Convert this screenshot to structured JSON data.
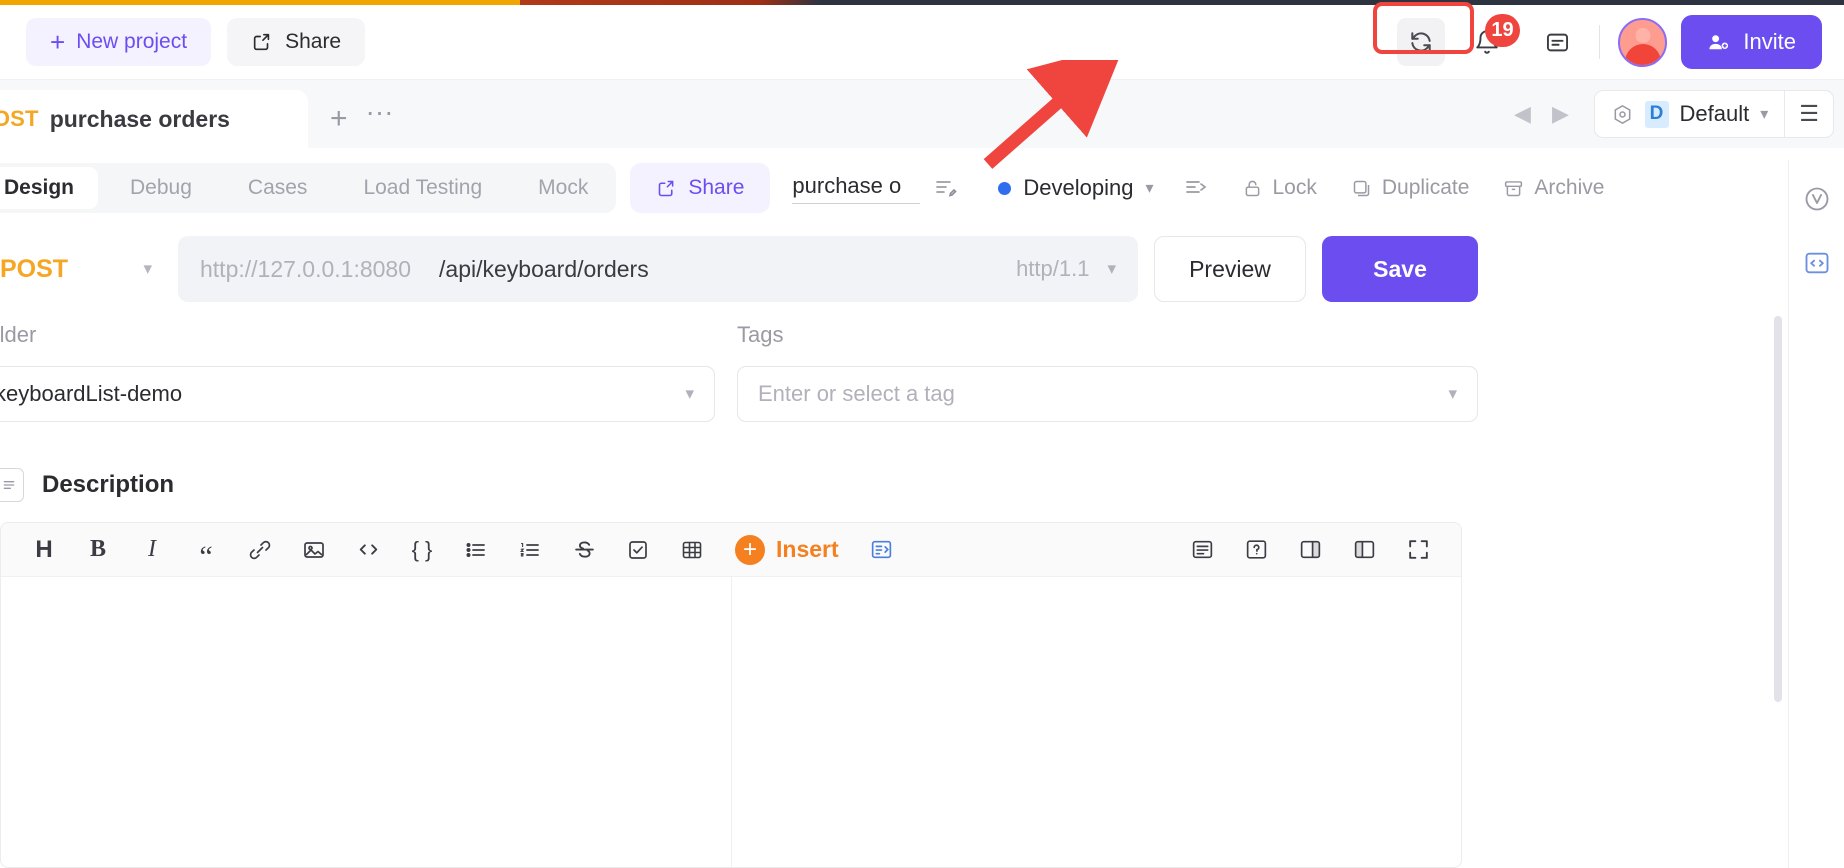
{
  "header": {
    "new_project_label": "New project",
    "share_label": "Share",
    "notification_count": "19",
    "invite_label": "Invite",
    "icons": {
      "plus": "plus-icon",
      "share": "share-icon",
      "refresh": "refresh-icon",
      "bell": "bell-icon",
      "note": "note-icon",
      "avatar": "avatar",
      "invite": "invite-user-icon"
    }
  },
  "tabbar": {
    "tab": {
      "method": "POST",
      "title": "purchase orders"
    },
    "add_tab_label": "+",
    "more_label": "···",
    "nav_prev": "◀",
    "nav_next": "▶",
    "environment": {
      "letter": "D",
      "name": "Default"
    }
  },
  "subtabs": {
    "items": [
      {
        "label": "Design",
        "active": true
      },
      {
        "label": "Debug",
        "active": false
      },
      {
        "label": "Cases",
        "active": false
      },
      {
        "label": "Load Testing",
        "active": false
      },
      {
        "label": "Mock",
        "active": false
      }
    ],
    "share_label": "Share",
    "api_name": "purchase o",
    "status": "Developing",
    "actions": [
      {
        "label": "Lock",
        "icon": "lock-icon"
      },
      {
        "label": "Duplicate",
        "icon": "copy-icon"
      },
      {
        "label": "Archive",
        "icon": "archive-icon"
      }
    ]
  },
  "request": {
    "method": "POST",
    "url_host_placeholder": "http://127.0.0.1:8080",
    "url_path": "/api/keyboard/orders",
    "protocol": "http/1.1",
    "preview_label": "Preview",
    "save_label": "Save"
  },
  "fields": {
    "folder_label": "Folder",
    "folder_value": "keyboardList-demo",
    "tags_label": "Tags",
    "tags_placeholder": "Enter or select a tag"
  },
  "description": {
    "title": "Description",
    "toolbar": [
      {
        "name": "heading-icon",
        "glyph": "H"
      },
      {
        "name": "bold-icon",
        "glyph": "B"
      },
      {
        "name": "italic-icon",
        "glyph": "I"
      },
      {
        "name": "quote-icon",
        "glyph": "“"
      },
      {
        "name": "link-icon",
        "glyph": "🔗"
      },
      {
        "name": "image-icon",
        "glyph": "▣"
      },
      {
        "name": "code-icon",
        "glyph": "</>"
      },
      {
        "name": "code-block-icon",
        "glyph": "{ }"
      },
      {
        "name": "bullet-list-icon",
        "glyph": "☰"
      },
      {
        "name": "ordered-list-icon",
        "glyph": "≡"
      },
      {
        "name": "strikethrough-icon",
        "glyph": "S"
      },
      {
        "name": "checklist-icon",
        "glyph": "☑"
      },
      {
        "name": "table-icon",
        "glyph": "▦"
      }
    ],
    "insert_label": "Insert",
    "right_toolbar": [
      {
        "name": "template-icon"
      },
      {
        "name": "help-icon"
      },
      {
        "name": "split-right-icon"
      },
      {
        "name": "split-left-icon"
      },
      {
        "name": "fullscreen-icon"
      }
    ]
  },
  "rail": [
    {
      "name": "version-icon",
      "glyph": "V"
    },
    {
      "name": "code-snippet-icon",
      "glyph": "</>"
    }
  ],
  "colors": {
    "accent": "#6c4df0",
    "method_post": "#f5a623",
    "status_dot": "#2f6fed",
    "badge": "#f0453f",
    "highlight": "#f0453f",
    "insert": "#f58020"
  }
}
